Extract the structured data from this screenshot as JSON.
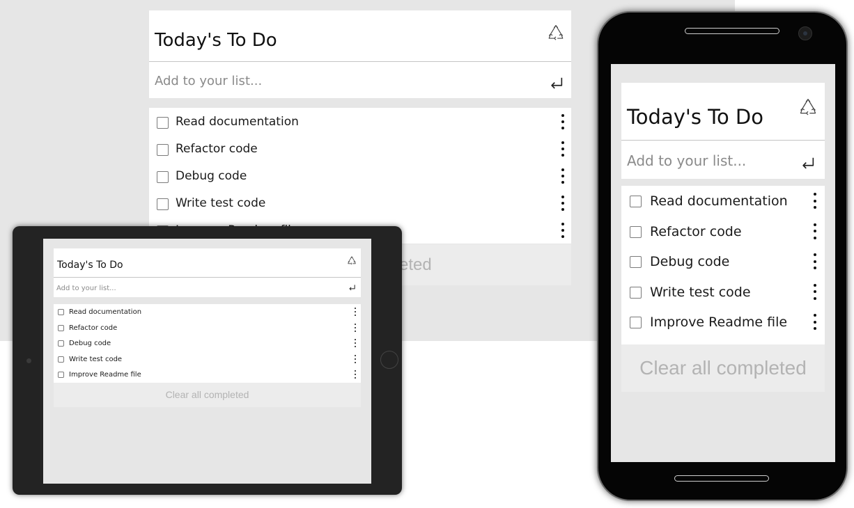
{
  "app": {
    "title": "Today's To Do",
    "add_placeholder": "Add to your list...",
    "clear_label": "Clear all completed",
    "items": [
      {
        "label": "Read documentation",
        "checked": false
      },
      {
        "label": "Refactor code",
        "checked": false
      },
      {
        "label": "Debug code",
        "checked": false
      },
      {
        "label": "Write test code",
        "checked": false
      },
      {
        "label": "Improve Readme file",
        "checked": false
      }
    ]
  },
  "icons": {
    "recycle": "recycle-icon",
    "enter": "enter-return-icon",
    "more": "more-vertical-icon"
  },
  "colors": {
    "background": "#e6e6e6",
    "card": "#ffffff",
    "clear_button_bg": "#ececec",
    "clear_button_text": "#b3b3b3",
    "device_frame": "#232323"
  }
}
